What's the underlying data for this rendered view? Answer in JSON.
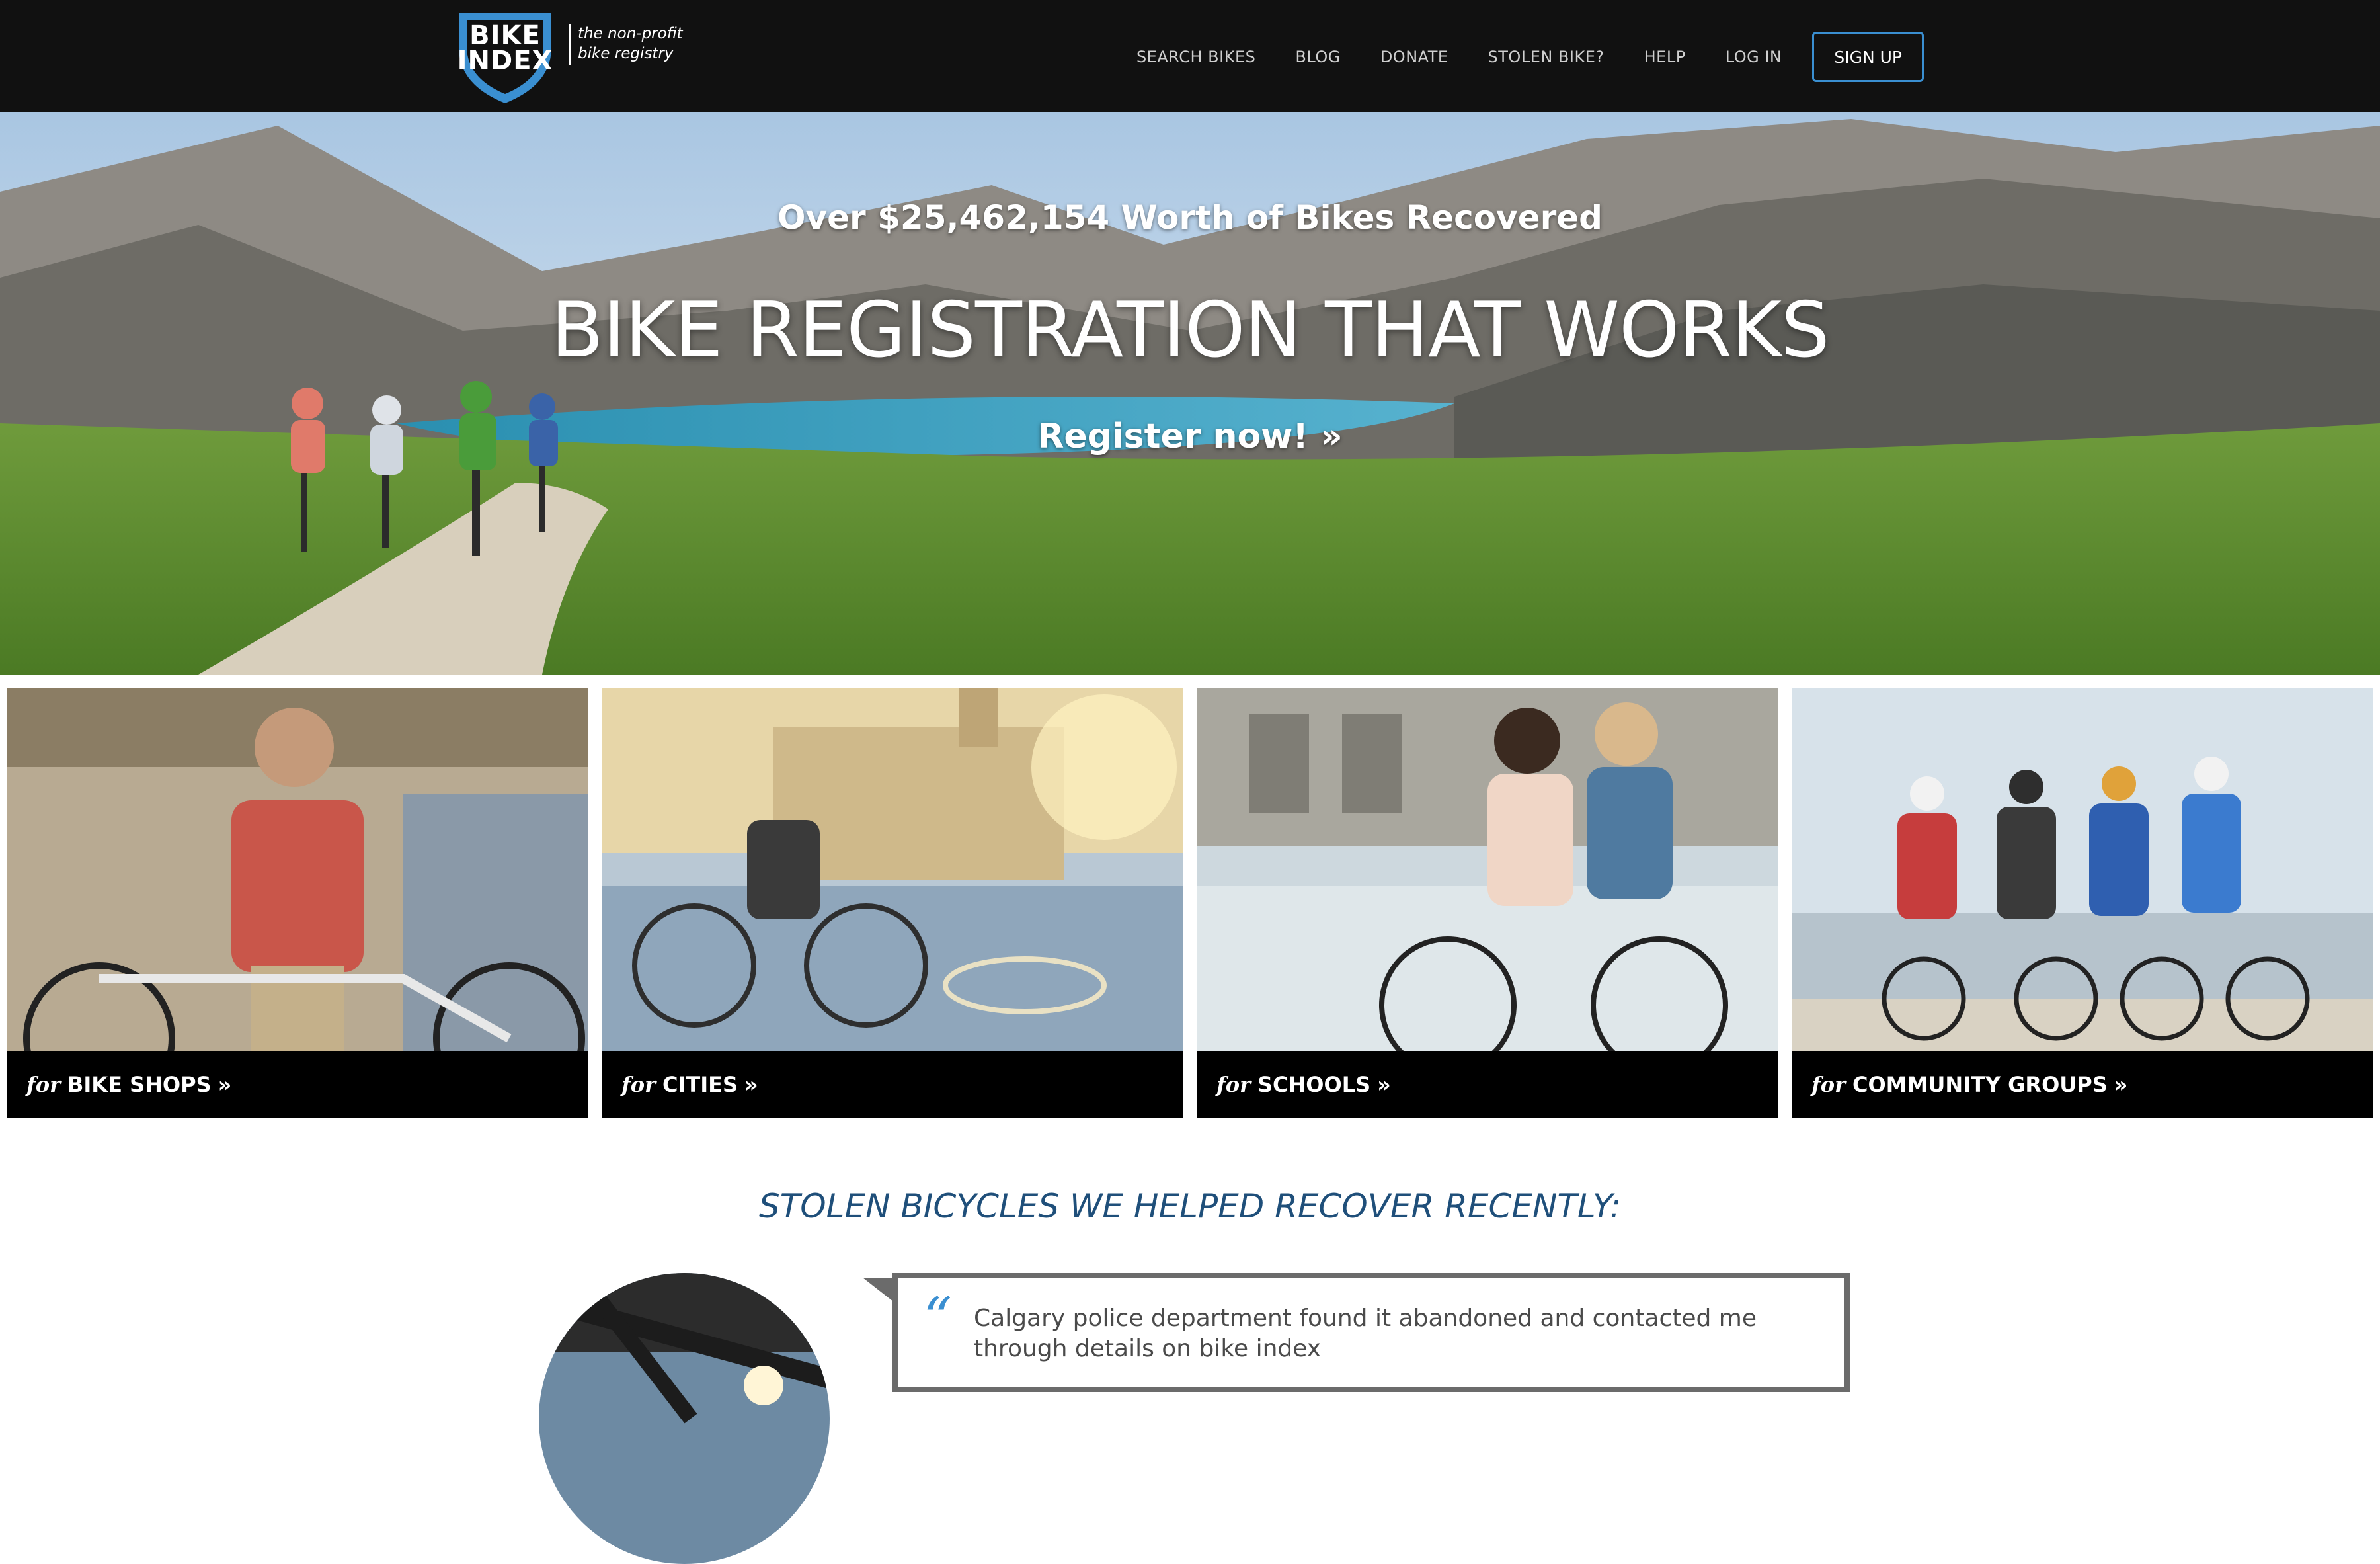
{
  "nav": {
    "logo": {
      "line1": "BIKE",
      "line2": "INDEX",
      "tagline1": "the non-profit",
      "tagline2": "bike registry"
    },
    "links": [
      "SEARCH BIKES",
      "BLOG",
      "DONATE",
      "STOLEN BIKE?",
      "HELP",
      "LOG IN"
    ],
    "signup": "SIGN UP"
  },
  "hero": {
    "kicker": "Over $25,462,154 Worth of Bikes Recovered",
    "title": "BIKE REGISTRATION THAT WORKS",
    "cta": "Register now! »"
  },
  "tiles": [
    {
      "for": "for",
      "label": "BIKE SHOPS",
      "arrow": "»"
    },
    {
      "for": "for",
      "label": "CITIES",
      "arrow": "»"
    },
    {
      "for": "for",
      "label": "SCHOOLS",
      "arrow": "»"
    },
    {
      "for": "for",
      "label": "COMMUNITY GROUPS",
      "arrow": "»"
    }
  ],
  "stolen": {
    "heading": "STOLEN BICYCLES WE HELPED RECOVER RECENTLY:",
    "quote_mark": "“",
    "quote": "Calgary police department found it abandoned and contacted me through details on bike index"
  },
  "colors": {
    "nav_bg": "#111111",
    "accent": "#3a8fd1",
    "heading": "#1f4f7a"
  }
}
